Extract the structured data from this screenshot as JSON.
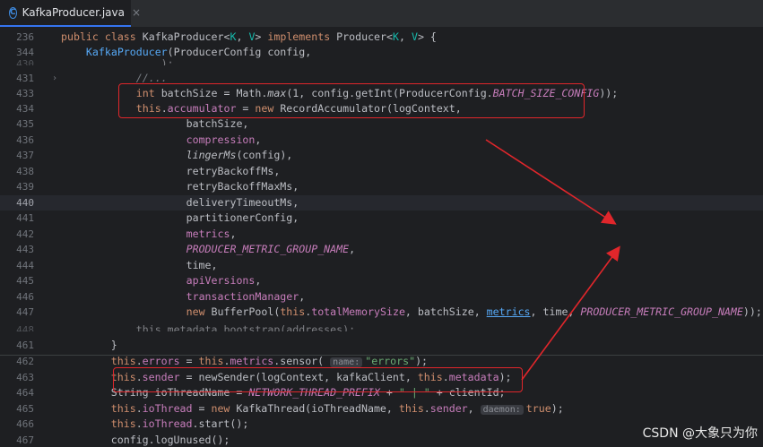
{
  "tab": {
    "title": "KafkaProducer.java",
    "icon": "C",
    "close": "×"
  },
  "lines": [
    {
      "n": "236",
      "segs": [
        [
          "kw",
          "public class "
        ],
        [
          "",
          "KafkaProducer<"
        ],
        [
          "gen",
          "K"
        ],
        [
          "",
          ", "
        ],
        [
          "gen",
          "V"
        ],
        [
          "",
          "> "
        ],
        [
          "kw",
          "implements "
        ],
        [
          "",
          "Producer<"
        ],
        [
          "gen",
          "K"
        ],
        [
          "",
          ", "
        ],
        [
          "gen",
          "V"
        ],
        [
          "",
          "> {"
        ]
      ]
    },
    {
      "n": "344",
      "segs": [
        [
          "",
          "    "
        ],
        [
          "fn",
          "KafkaProducer"
        ],
        [
          "",
          "(ProducerConfig config,"
        ]
      ]
    },
    {
      "n": "430",
      "segs": [
        [
          "",
          "                );"
        ]
      ]
    },
    {
      "n": "431",
      "segs": [
        [
          "",
          "            "
        ],
        [
          "cm",
          "//..."
        ]
      ]
    },
    {
      "n": "433",
      "segs": [
        [
          "",
          "            "
        ],
        [
          "kw",
          "int "
        ],
        [
          "",
          "batchSize = Math."
        ],
        [
          "it",
          "max"
        ],
        [
          "",
          "(1, config.getInt(ProducerConfig."
        ],
        [
          "cst",
          "BATCH_SIZE_CONFIG"
        ],
        [
          "",
          "));"
        ]
      ]
    },
    {
      "n": "434",
      "segs": [
        [
          "",
          "            "
        ],
        [
          "kw",
          "this"
        ],
        [
          "",
          "."
        ],
        [
          "fld",
          "accumulator"
        ],
        [
          "",
          " = "
        ],
        [
          "kw",
          "new "
        ],
        [
          "",
          "RecordAccumulator(logContext,"
        ]
      ]
    },
    {
      "n": "435",
      "segs": [
        [
          "",
          "                    batchSize,"
        ]
      ]
    },
    {
      "n": "436",
      "segs": [
        [
          "",
          "                    "
        ],
        [
          "fld",
          "compression"
        ],
        [
          "",
          ","
        ]
      ]
    },
    {
      "n": "437",
      "segs": [
        [
          "",
          "                    "
        ],
        [
          "it",
          "lingerMs"
        ],
        [
          "",
          "(config),"
        ]
      ]
    },
    {
      "n": "438",
      "segs": [
        [
          "",
          "                    retryBackoffMs,"
        ]
      ]
    },
    {
      "n": "439",
      "segs": [
        [
          "",
          "                    retryBackoffMaxMs,"
        ]
      ]
    },
    {
      "n": "440",
      "segs": [
        [
          "",
          "                    deliveryTimeoutMs,"
        ]
      ]
    },
    {
      "n": "441",
      "segs": [
        [
          "",
          "                    partitionerConfig,"
        ]
      ]
    },
    {
      "n": "442",
      "segs": [
        [
          "",
          "                    "
        ],
        [
          "fld",
          "metrics"
        ],
        [
          "",
          ","
        ]
      ]
    },
    {
      "n": "443",
      "segs": [
        [
          "",
          "                    "
        ],
        [
          "cst",
          "PRODUCER_METRIC_GROUP_NAME"
        ],
        [
          "",
          ","
        ]
      ]
    },
    {
      "n": "444",
      "segs": [
        [
          "",
          "                    time,"
        ]
      ]
    },
    {
      "n": "445",
      "segs": [
        [
          "",
          "                    "
        ],
        [
          "fld",
          "apiVersions"
        ],
        [
          "",
          ","
        ]
      ]
    },
    {
      "n": "446",
      "segs": [
        [
          "",
          "                    "
        ],
        [
          "fld",
          "transactionManager"
        ],
        [
          "",
          ","
        ]
      ]
    },
    {
      "n": "447",
      "segs": [
        [
          "",
          "                    "
        ],
        [
          "kw",
          "new "
        ],
        [
          "",
          "BufferPool("
        ],
        [
          "kw",
          "this"
        ],
        [
          "",
          "."
        ],
        [
          "fld",
          "totalMemorySize"
        ],
        [
          "",
          ", batchSize, "
        ],
        [
          "lnk",
          "metrics"
        ],
        [
          "",
          ", time, "
        ],
        [
          "cst",
          "PRODUCER_METRIC_GROUP_NAME"
        ],
        [
          "",
          "));"
        ]
      ]
    },
    {
      "n": "448",
      "segs": [
        [
          "",
          "            this.metadata.bootstrap(addresses);"
        ]
      ]
    },
    {
      "n": "461",
      "segs": [
        [
          "",
          "            }"
        ]
      ]
    },
    {
      "n": "462",
      "segs": [
        [
          "",
          "            "
        ],
        [
          "kw",
          "this"
        ],
        [
          "",
          "."
        ],
        [
          "fld",
          "errors"
        ],
        [
          "",
          " = "
        ],
        [
          "kw",
          "this"
        ],
        [
          "",
          "."
        ],
        [
          "fld",
          "metrics"
        ],
        [
          "",
          ".sensor( "
        ],
        [
          "hint",
          "name:"
        ],
        [
          "str",
          "\"errors\""
        ],
        [
          "",
          ");"
        ]
      ]
    },
    {
      "n": "463",
      "segs": [
        [
          "",
          "            "
        ],
        [
          "kw",
          "this"
        ],
        [
          "",
          "."
        ],
        [
          "fld",
          "sender"
        ],
        [
          "",
          " = newSender(logContext, kafkaClient, "
        ],
        [
          "kw",
          "this"
        ],
        [
          "",
          "."
        ],
        [
          "fld",
          "metadata"
        ],
        [
          "",
          ");"
        ]
      ]
    },
    {
      "n": "464",
      "segs": [
        [
          "",
          "            String ioThreadName = "
        ],
        [
          "cst",
          "NETWORK_THREAD_PREFIX"
        ],
        [
          "",
          " + "
        ],
        [
          "str",
          "\" | \""
        ],
        [
          "",
          " + clientId;"
        ]
      ]
    },
    {
      "n": "465",
      "segs": [
        [
          "",
          "            "
        ],
        [
          "kw",
          "this"
        ],
        [
          "",
          "."
        ],
        [
          "fld",
          "ioThread"
        ],
        [
          "",
          " = "
        ],
        [
          "kw",
          "new "
        ],
        [
          "",
          "KafkaThread(ioThreadName, "
        ],
        [
          "kw",
          "this"
        ],
        [
          "",
          "."
        ],
        [
          "fld",
          "sender"
        ],
        [
          "",
          ", "
        ],
        [
          "hint",
          "daemon:"
        ],
        [
          "kw",
          "true"
        ],
        [
          "",
          ");"
        ]
      ]
    },
    {
      "n": "466",
      "segs": [
        [
          "",
          "            "
        ],
        [
          "kw",
          "this"
        ],
        [
          "",
          "."
        ],
        [
          "fld",
          "ioThread"
        ],
        [
          "",
          ".start();"
        ]
      ]
    },
    {
      "n": "467",
      "segs": [
        [
          "",
          "            config.logUnused();"
        ]
      ]
    }
  ],
  "watermark": "CSDN @大象只为你",
  "colors": {
    "highlight": "#e0262b",
    "background": "#1e1f22",
    "keyword": "#cf8e6d",
    "field": "#c77dbb",
    "method": "#56a8f5"
  }
}
